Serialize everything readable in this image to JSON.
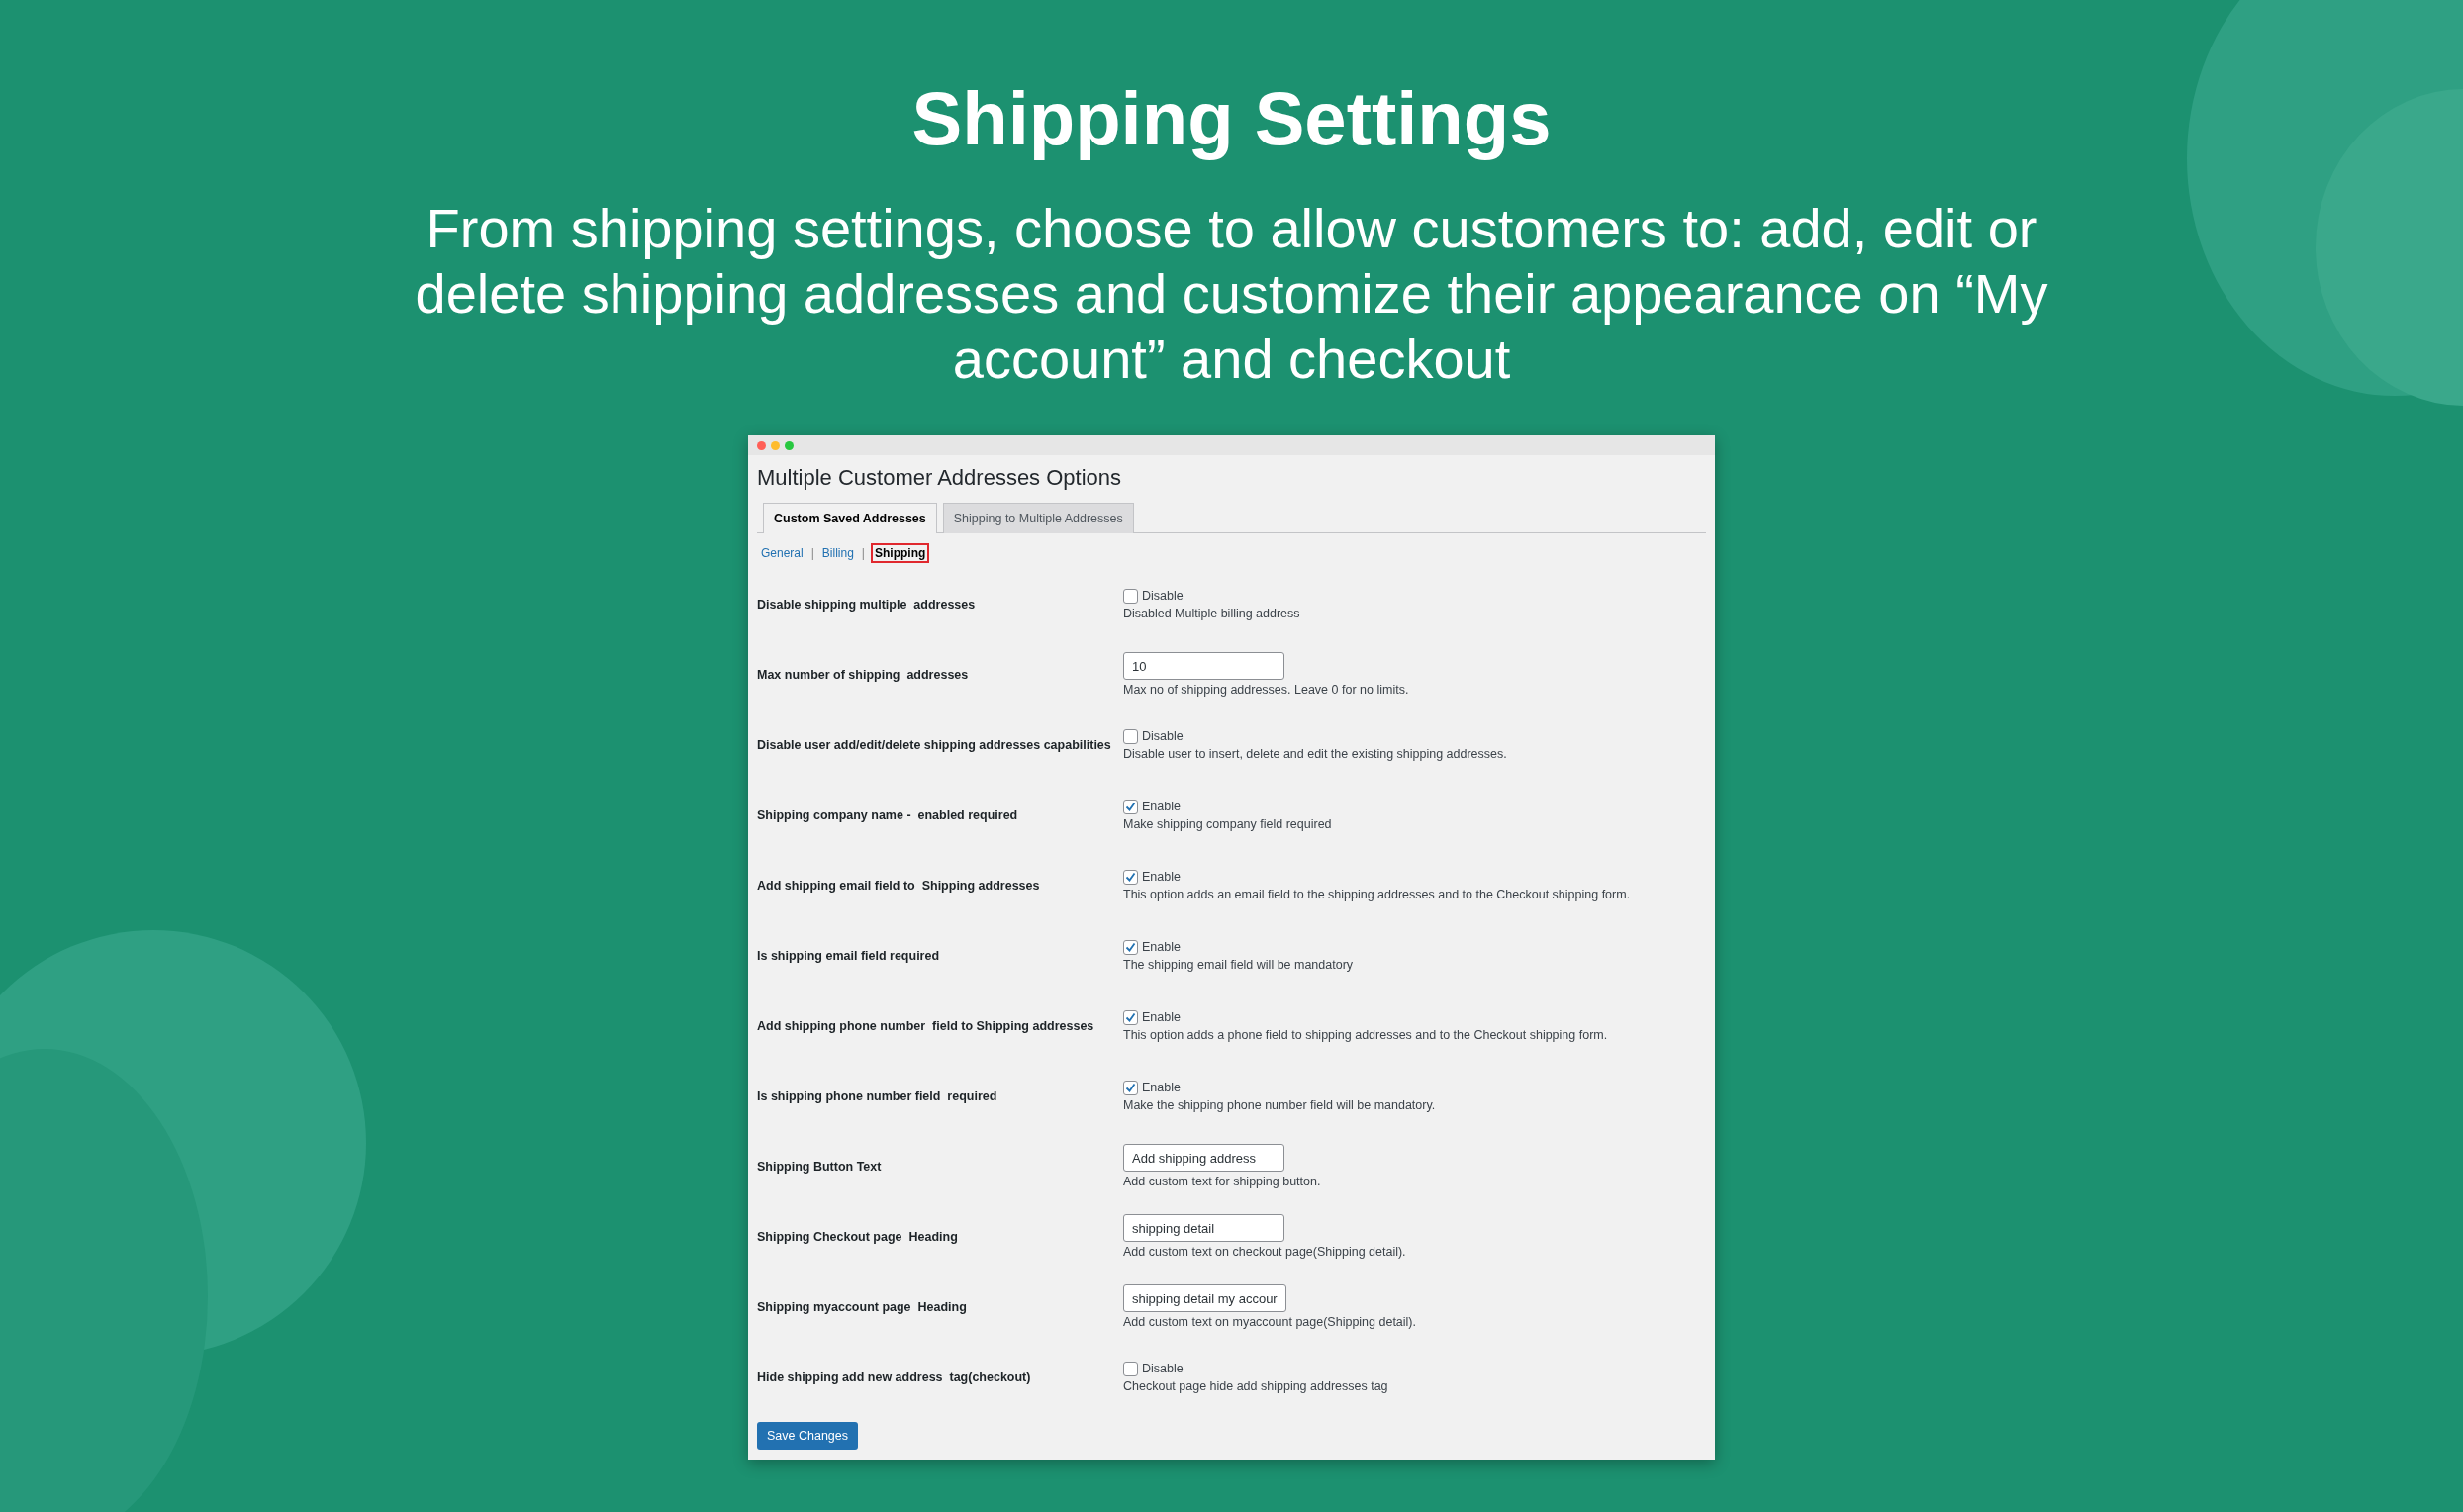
{
  "headline": "Shipping Settings",
  "subtitle": "From shipping settings, choose to allow customers to: add, edit or delete shipping addresses and customize their appearance on “My account” and checkout",
  "window": {
    "title": "Multiple Customer Addresses Options",
    "tabs": [
      {
        "label": "Custom Saved Addresses",
        "selected": true
      },
      {
        "label": "Shipping to Multiple Addresses",
        "selected": false
      }
    ],
    "subtabs": [
      {
        "label": "General",
        "selected": false
      },
      {
        "label": "Billing",
        "selected": false
      },
      {
        "label": "Shipping",
        "selected": true
      }
    ],
    "subtab_separator": "|",
    "settings": [
      {
        "kind": "checkbox",
        "label": "Disable shipping multiple  addresses",
        "option": "Disable",
        "checked": false,
        "description": "Disabled Multiple billing address"
      },
      {
        "kind": "text",
        "label": "Max number of shipping  addresses",
        "value": "10",
        "description": "Max no of shipping addresses. Leave 0 for no limits."
      },
      {
        "kind": "checkbox",
        "label": "Disable user add/edit/delete shipping addresses capabilities",
        "option": "Disable",
        "checked": false,
        "description": "Disable user to insert, delete and edit the existing shipping addresses."
      },
      {
        "kind": "checkbox",
        "label": "Shipping company name -  enabled required",
        "option": "Enable",
        "checked": true,
        "description": "Make shipping company field required"
      },
      {
        "kind": "checkbox",
        "label": "Add shipping email field to  Shipping addresses",
        "option": "Enable",
        "checked": true,
        "description": "This option adds an email field to the shipping addresses and to the Checkout shipping form."
      },
      {
        "kind": "checkbox",
        "label": "Is shipping email field required",
        "option": "Enable",
        "checked": true,
        "description": "The shipping email field will be mandatory"
      },
      {
        "kind": "checkbox",
        "label": "Add shipping phone number  field to Shipping addresses",
        "option": "Enable",
        "checked": true,
        "description": "This option adds a phone field to shipping addresses and to the Checkout shipping form."
      },
      {
        "kind": "checkbox",
        "label": "Is shipping phone number field  required",
        "option": "Enable",
        "checked": true,
        "description": "Make the shipping phone number field will be mandatory."
      },
      {
        "kind": "text",
        "label": "Shipping Button Text",
        "value": "Add shipping address",
        "description": "Add custom text for shipping button."
      },
      {
        "kind": "text",
        "label": "Shipping Checkout page  Heading",
        "value": "shipping detail",
        "description": "Add custom text on checkout page(Shipping detail)."
      },
      {
        "kind": "text",
        "label": "Shipping myaccount page  Heading",
        "value": "shipping detail my accour",
        "description": "Add custom text on myaccount page(Shipping detail)."
      },
      {
        "kind": "checkbox",
        "label": "Hide shipping add new address  tag(checkout)",
        "option": "Disable",
        "checked": false,
        "description": "Checkout page hide add shipping addresses tag"
      }
    ],
    "save_button": "Save Changes"
  }
}
